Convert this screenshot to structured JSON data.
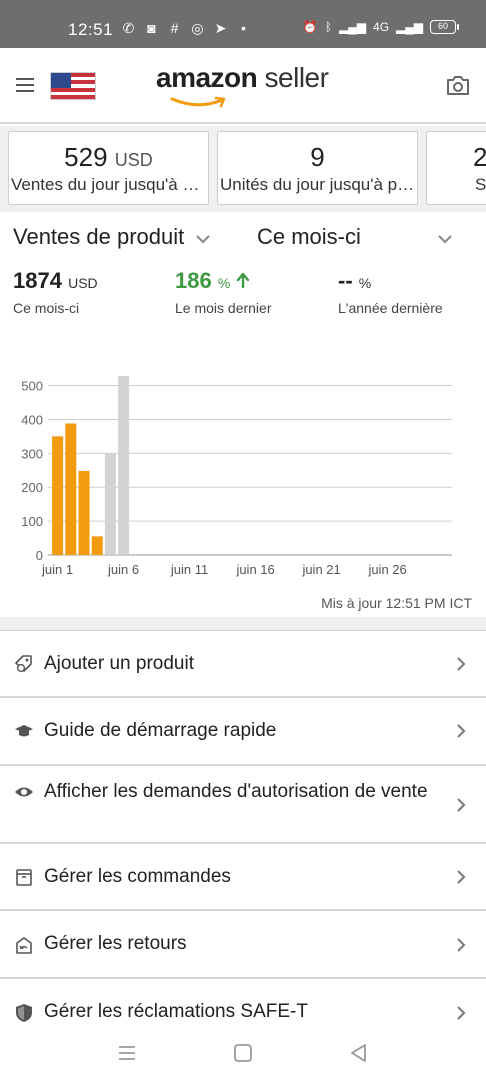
{
  "status_bar": {
    "time": "12:51",
    "battery": "60",
    "network": "4G"
  },
  "header": {
    "logo_bold": "amazon",
    "logo_rest": " seller",
    "flag": "us-flag-icon"
  },
  "cards": [
    {
      "value": "529",
      "unit": "USD",
      "label": "Ventes du jour jusqu'à présent"
    },
    {
      "value": "9",
      "unit": "",
      "label": "Unités du jour jusqu'à présent"
    },
    {
      "value": "2",
      "unit": "",
      "label": "S"
    }
  ],
  "sales": {
    "selector_metric": "Ventes de produit",
    "selector_period": "Ce mois-ci",
    "stats": [
      {
        "value": "1874",
        "unit": "USD",
        "label": "Ce mois-ci",
        "trend": ""
      },
      {
        "value": "186",
        "unit": "%",
        "label": "Le mois dernier",
        "trend": "up"
      },
      {
        "value": "--",
        "unit": "%",
        "label": "L'année dernière",
        "trend": ""
      }
    ],
    "updated": "Mis à jour 12:51 PM ICT"
  },
  "chart_data": {
    "type": "bar",
    "categories": [
      "juin 1",
      "juin 2",
      "juin 3",
      "juin 4",
      "juin 5",
      "juin 6",
      "juin 7",
      "juin 8",
      "juin 9",
      "juin 10",
      "juin 11",
      "juin 12",
      "juin 13",
      "juin 14",
      "juin 15",
      "juin 16",
      "juin 17",
      "juin 18",
      "juin 19",
      "juin 20",
      "juin 21",
      "juin 22",
      "juin 23",
      "juin 24",
      "juin 25",
      "juin 26",
      "juin 27",
      "juin 28",
      "juin 29",
      "juin 30"
    ],
    "x_tick_labels": [
      "juin 1",
      "juin 6",
      "juin 11",
      "juin 16",
      "juin 21",
      "juin 26"
    ],
    "x_tick_days": [
      1,
      6,
      11,
      16,
      21,
      26
    ],
    "series": [
      {
        "values": [
          350,
          388,
          248,
          55,
          null,
          null,
          null,
          null,
          null,
          null,
          null,
          null,
          null,
          null,
          null,
          null,
          null,
          null,
          null,
          null,
          null,
          null,
          null,
          null,
          null,
          null,
          null,
          null,
          null,
          null
        ],
        "color": "#f39a0e"
      },
      {
        "values": [
          null,
          null,
          null,
          null,
          300,
          528,
          null,
          null,
          null,
          null,
          null,
          null,
          null,
          null,
          null,
          null,
          null,
          null,
          null,
          null,
          null,
          null,
          null,
          null,
          null,
          null,
          null,
          null,
          null,
          null
        ],
        "color": "#d3d3d3"
      }
    ],
    "y_ticks": [
      0,
      100,
      200,
      300,
      400,
      500
    ],
    "ylim": [
      0,
      540
    ],
    "grid": true,
    "legend": "none"
  },
  "menu": [
    {
      "label": "Ajouter un produit",
      "icon": "tag-icon"
    },
    {
      "label": "Guide de démarrage rapide",
      "icon": "graduation-cap-icon"
    },
    {
      "label": "Afficher les demandes d'autorisation de vente",
      "icon": "eye-icon"
    },
    {
      "label": "Gérer les commandes",
      "icon": "box-icon"
    },
    {
      "label": "Gérer les retours",
      "icon": "return-box-icon"
    },
    {
      "label": "Gérer les réclamations SAFE-T",
      "icon": "shield-icon"
    }
  ],
  "colors": {
    "accent_orange": "#f39a0e",
    "positive_green": "#3d9a40",
    "bar_gray": "#d3d3d3"
  }
}
